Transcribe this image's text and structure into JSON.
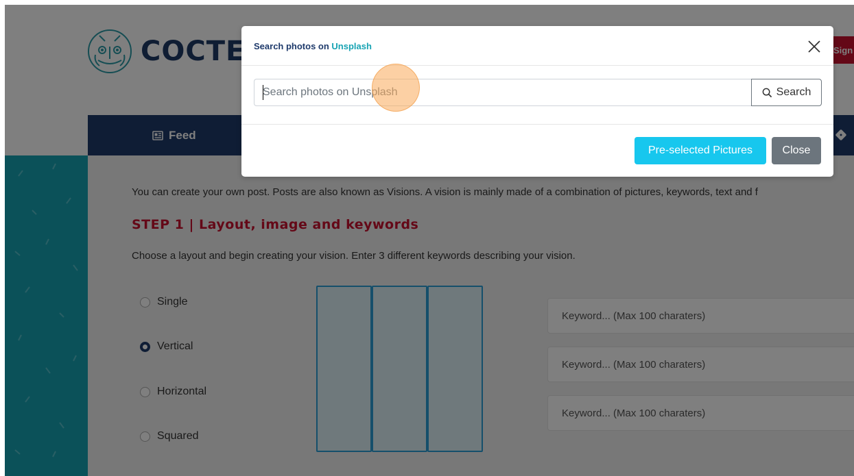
{
  "header": {
    "logo_text": "COCTEAU",
    "signup_label": "Sign up"
  },
  "nav": {
    "feed_label": "Feed",
    "feed_icon": "newspaper-icon",
    "right_icon": "dice-icon"
  },
  "content": {
    "intro": "You can create your own post. Posts are also known as Visions. A vision is mainly made of a combination of pictures, keywords, text and f",
    "step_title": "STEP 1 | Layout, image and keywords",
    "step_desc": "Choose a layout and begin creating your vision. Enter 3 different keywords describing your vision.",
    "layouts": [
      {
        "label": "Single",
        "checked": false
      },
      {
        "label": "Vertical",
        "checked": true
      },
      {
        "label": "Horizontal",
        "checked": false
      },
      {
        "label": "Squared",
        "checked": false
      }
    ],
    "keyword_placeholder": "Keyword... (Max 100 charaters)"
  },
  "modal": {
    "title_prefix": "Search photos on ",
    "title_accent": "Unsplash",
    "search_placeholder": "Search photos on Unsplash",
    "search_value": "",
    "search_button": "Search",
    "preselected_button": "Pre-selected Pictures",
    "close_button": "Close"
  },
  "colors": {
    "navy": "#1e3a6b",
    "teal": "#17a3b3",
    "red": "#c8102e",
    "cyan_button": "#17c7ee",
    "gray_button": "#6c757d"
  }
}
